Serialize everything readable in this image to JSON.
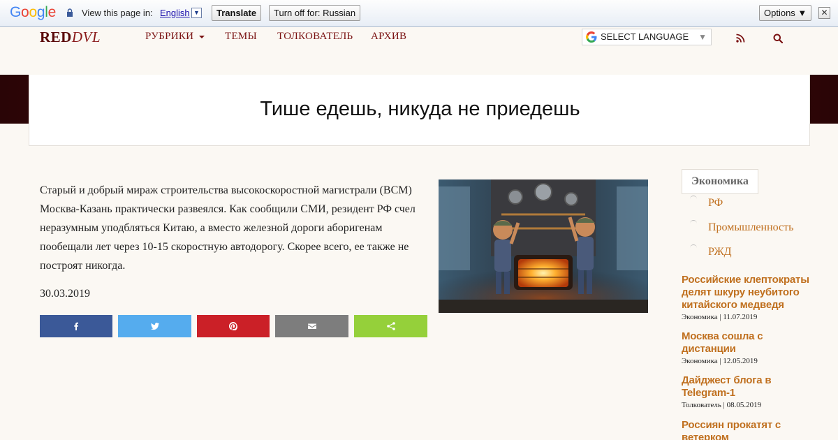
{
  "translate_bar": {
    "view_label": "View this page in:",
    "language": "English",
    "dropdown_glyph": "▼",
    "translate_label": "Translate",
    "turn_off_label": "Turn off for: Russian",
    "options_label": "Options ▼",
    "close_glyph": "✕"
  },
  "site": {
    "logo_main": "RED",
    "logo_sub": "DVL",
    "nav": [
      "РУБРИКИ",
      "ТЕМЫ",
      "ТОЛКОВАТЕЛЬ",
      "АРХИВ"
    ],
    "language_select": "SELECT LANGUAGE",
    "language_arrow": "▼"
  },
  "article": {
    "title": "Тише едешь, никуда не приедешь",
    "text": "Старый и добрый мираж строительства высокоскоростной магистрали (ВСМ) Москва-Казань практически развеялся. Как сообщили СМИ, резидент РФ счел неразумным уподбляться Китаю, а вместо железной дороги аборигенам пообещали лет через 10-15 скоростную автодорогу. Скорее всего, ее также не построят никогда.",
    "date": "30.03.2019"
  },
  "sidebar": {
    "category": "Экономика",
    "tags": [
      "РФ",
      "Промышленность",
      "РЖД"
    ],
    "posts": [
      {
        "title": "Российские клептократы делят шкуру неубитого китайского медведя",
        "meta": "Экономика | 11.07.2019"
      },
      {
        "title": "Москва сошла с дистанции",
        "meta": "Экономика | 12.05.2019"
      },
      {
        "title": "Дайджест блога в Telegram-1",
        "meta": "Толкователь | 08.05.2019"
      },
      {
        "title": "Россиян прокатят с ветерком",
        "meta": ""
      }
    ]
  },
  "colors": {
    "accent": "#c0701f",
    "nav": "#7a1212",
    "hero": "#3a0708"
  }
}
